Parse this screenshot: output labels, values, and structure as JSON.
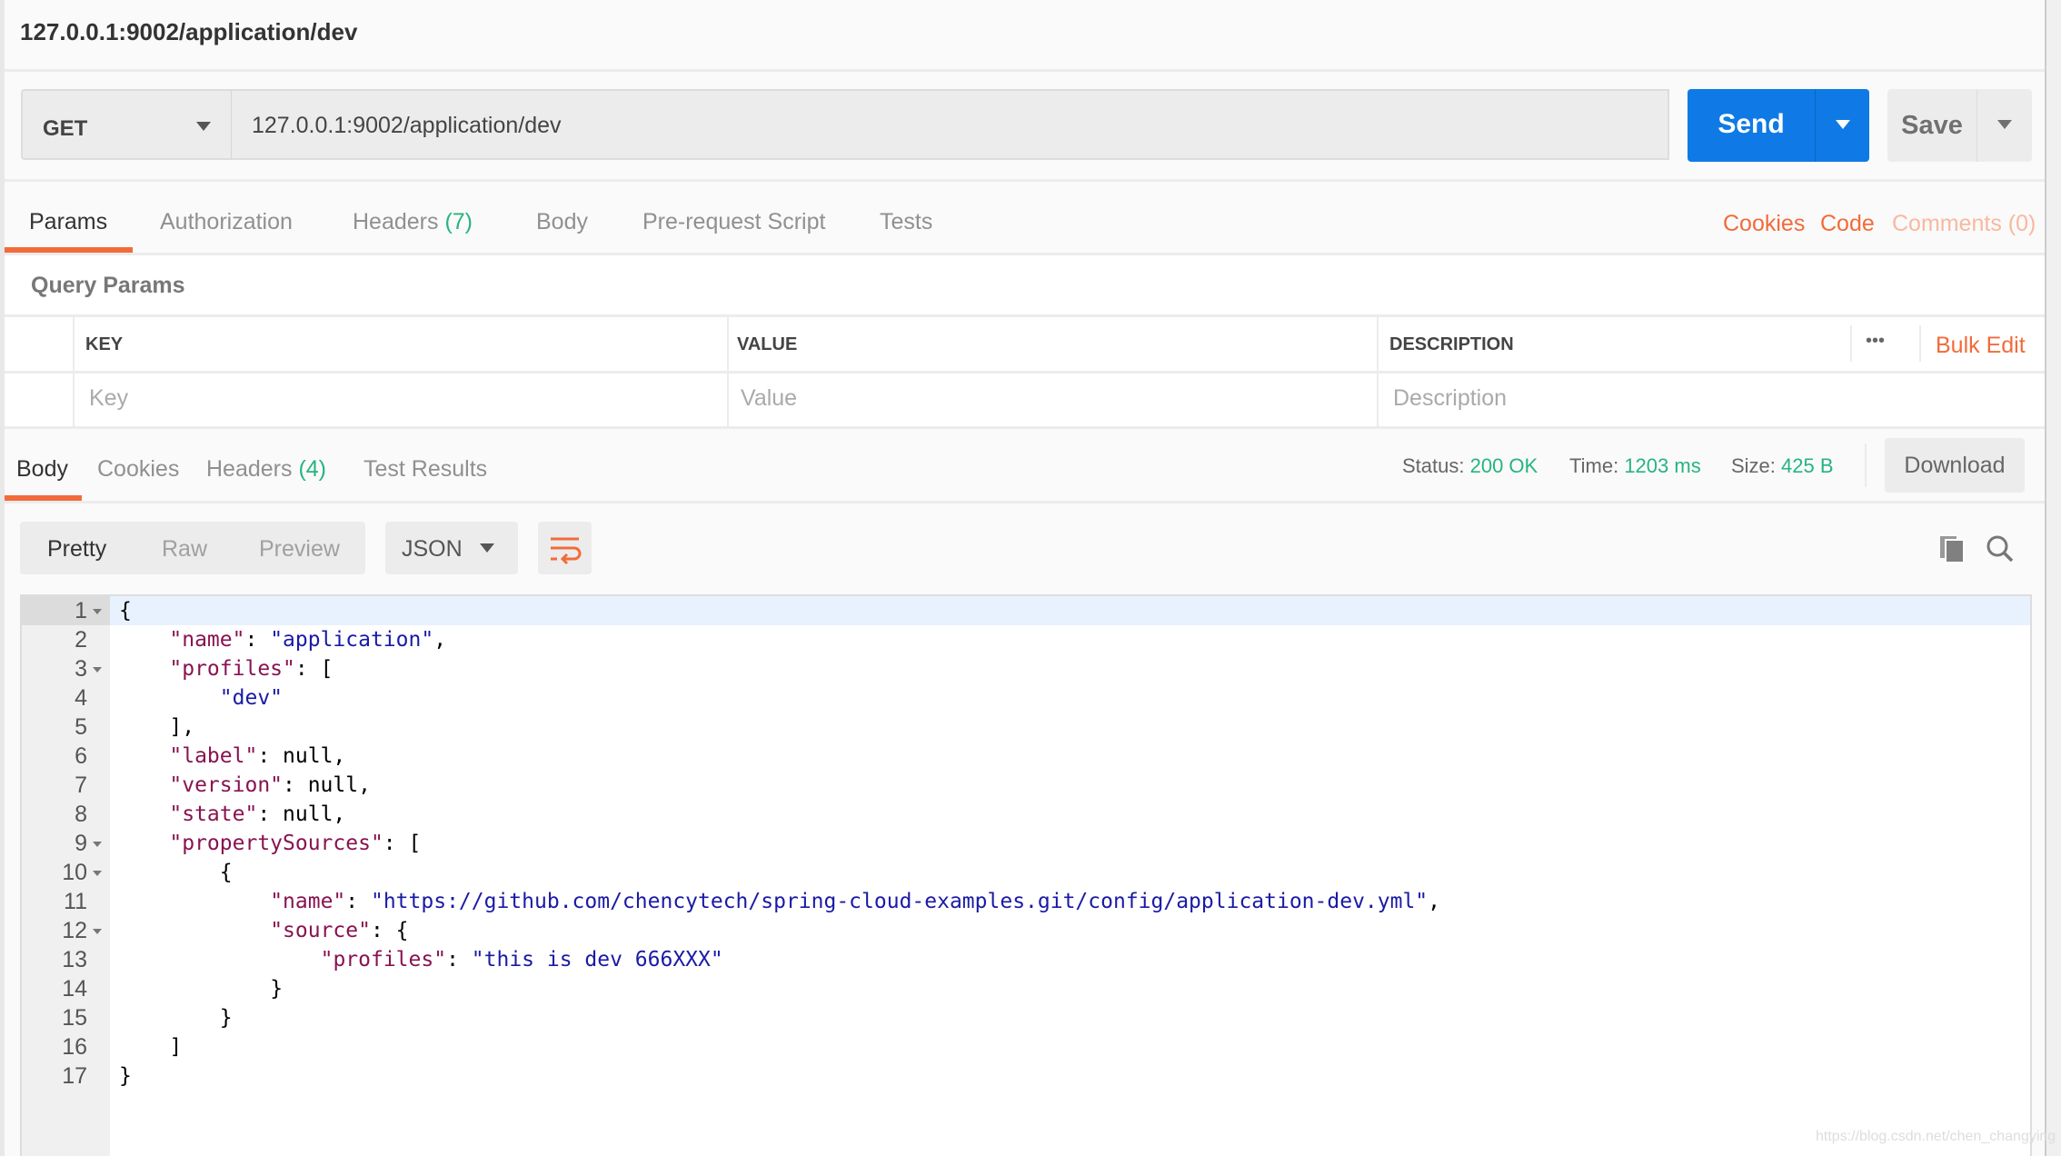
{
  "title": "127.0.0.1:9002/application/dev",
  "request": {
    "method": "GET",
    "url": "127.0.0.1:9002/application/dev",
    "send_label": "Send",
    "save_label": "Save"
  },
  "request_tabs": [
    {
      "label": "Params",
      "active": true
    },
    {
      "label": "Authorization"
    },
    {
      "label": "Headers",
      "count": "(7)"
    },
    {
      "label": "Body"
    },
    {
      "label": "Pre-request Script"
    },
    {
      "label": "Tests"
    }
  ],
  "request_links": {
    "cookies": "Cookies",
    "code": "Code",
    "comments": "Comments (0)"
  },
  "query_params": {
    "title": "Query Params",
    "headers": [
      "KEY",
      "VALUE",
      "DESCRIPTION"
    ],
    "placeholders": [
      "Key",
      "Value",
      "Description"
    ],
    "more": "•••",
    "bulk_edit": "Bulk Edit"
  },
  "response_tabs": [
    {
      "label": "Body",
      "active": true
    },
    {
      "label": "Cookies"
    },
    {
      "label": "Headers",
      "count": "(4)"
    },
    {
      "label": "Test Results"
    }
  ],
  "response_meta": {
    "status_label": "Status:",
    "status": "200 OK",
    "time_label": "Time:",
    "time": "1203 ms",
    "size_label": "Size:",
    "size": "425 B",
    "download": "Download"
  },
  "view_modes": [
    "Pretty",
    "Raw",
    "Preview"
  ],
  "active_view": "Pretty",
  "format": "JSON",
  "colors": {
    "accent": "#f26b3a",
    "send": "#0f7ae5",
    "success": "#26b47f",
    "json_key": "#881350",
    "json_string": "#1a1aa6"
  },
  "code_lines": [
    {
      "n": "1",
      "fold": true,
      "indent": 0,
      "tokens": [
        [
          "p",
          "{"
        ]
      ]
    },
    {
      "n": "2",
      "indent": 1,
      "tokens": [
        [
          "k",
          "\"name\""
        ],
        [
          "p",
          ": "
        ],
        [
          "s",
          "\"application\""
        ],
        [
          "p",
          ","
        ]
      ]
    },
    {
      "n": "3",
      "fold": true,
      "indent": 1,
      "tokens": [
        [
          "k",
          "\"profiles\""
        ],
        [
          "p",
          ": ["
        ]
      ]
    },
    {
      "n": "4",
      "indent": 2,
      "tokens": [
        [
          "s",
          "\"dev\""
        ]
      ]
    },
    {
      "n": "5",
      "indent": 1,
      "tokens": [
        [
          "p",
          "],"
        ]
      ]
    },
    {
      "n": "6",
      "indent": 1,
      "tokens": [
        [
          "k",
          "\"label\""
        ],
        [
          "p",
          ": null,"
        ]
      ]
    },
    {
      "n": "7",
      "indent": 1,
      "tokens": [
        [
          "k",
          "\"version\""
        ],
        [
          "p",
          ": null,"
        ]
      ]
    },
    {
      "n": "8",
      "indent": 1,
      "tokens": [
        [
          "k",
          "\"state\""
        ],
        [
          "p",
          ": null,"
        ]
      ]
    },
    {
      "n": "9",
      "fold": true,
      "indent": 1,
      "tokens": [
        [
          "k",
          "\"propertySources\""
        ],
        [
          "p",
          ": ["
        ]
      ]
    },
    {
      "n": "10",
      "fold": true,
      "indent": 2,
      "tokens": [
        [
          "p",
          "{"
        ]
      ]
    },
    {
      "n": "11",
      "indent": 3,
      "tokens": [
        [
          "k",
          "\"name\""
        ],
        [
          "p",
          ": "
        ],
        [
          "s",
          "\"https://github.com/chencytech/spring-cloud-examples.git/config/application-dev.yml\""
        ],
        [
          "p",
          ","
        ]
      ]
    },
    {
      "n": "12",
      "fold": true,
      "indent": 3,
      "tokens": [
        [
          "k",
          "\"source\""
        ],
        [
          "p",
          ": {"
        ]
      ]
    },
    {
      "n": "13",
      "indent": 4,
      "tokens": [
        [
          "k",
          "\"profiles\""
        ],
        [
          "p",
          ": "
        ],
        [
          "s",
          "\"this is dev 666XXX\""
        ]
      ]
    },
    {
      "n": "14",
      "indent": 3,
      "tokens": [
        [
          "p",
          "}"
        ]
      ]
    },
    {
      "n": "15",
      "indent": 2,
      "tokens": [
        [
          "p",
          "}"
        ]
      ]
    },
    {
      "n": "16",
      "indent": 1,
      "tokens": [
        [
          "p",
          "]"
        ]
      ]
    },
    {
      "n": "17",
      "indent": 0,
      "tokens": [
        [
          "p",
          "}"
        ]
      ]
    }
  ],
  "watermark": "https://blog.csdn.net/chen_changying"
}
